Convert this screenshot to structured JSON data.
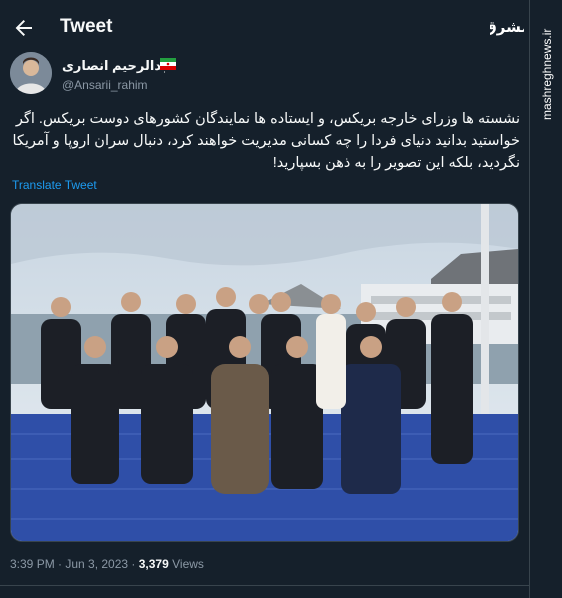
{
  "header": {
    "title": "Tweet"
  },
  "watermark": {
    "site": "mashreghnews.ir",
    "logo_text": "مشرق"
  },
  "tweet": {
    "author_name": "عبدالرحیم انصاری",
    "author_handle": "@Ansarii_rahim",
    "text": "نشسته ها وزرای خارجه بریکس، و ایستاده ها نمایندگان کشورهای دوست بریکس. اگر خواستید بدانید دنیای فردا را چه کسانی مدیریت خواهند کرد، دنبال سران اروپا و آمریکا نگردید، بلکه این تصویر را به ذهن بسپارید!",
    "translate_label": "Translate Tweet",
    "time": "3:39 PM · Jun 3, 2023 · ",
    "views_count": "3,379",
    "views_label": " Views"
  },
  "colors": {
    "background": "#15202b",
    "accent": "#1d9bf0",
    "muted": "#8b98a5"
  }
}
